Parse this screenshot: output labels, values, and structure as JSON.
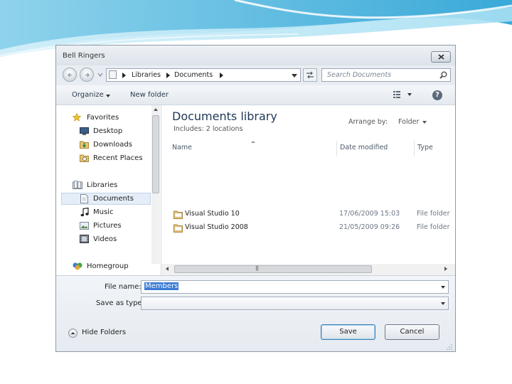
{
  "dialog": {
    "title": "Bell Ringers"
  },
  "address_bar": {
    "crumbs": [
      "Libraries",
      "Documents"
    ],
    "search_placeholder": "Search Documents"
  },
  "toolbar": {
    "organize": "Organize",
    "new_folder": "New folder"
  },
  "nav_pane": {
    "favorites": "Favorites",
    "desktop": "Desktop",
    "downloads": "Downloads",
    "recent_places": "Recent Places",
    "libraries": "Libraries",
    "documents": "Documents",
    "music": "Music",
    "pictures": "Pictures",
    "videos": "Videos",
    "homegroup": "Homegroup"
  },
  "content": {
    "library_title": "Documents library",
    "includes": "Includes: 2 locations",
    "arrange_by_label": "Arrange by:",
    "arrange_by_value": "Folder",
    "columns": {
      "name": "Name",
      "date_modified": "Date modified",
      "type": "Type"
    },
    "rows": [
      {
        "name": "Visual Studio 10",
        "date": "17/06/2009 15:03",
        "type": "File folder"
      },
      {
        "name": "Visual Studio 2008",
        "date": "21/05/2009 09:26",
        "type": "File folder"
      }
    ]
  },
  "footer": {
    "file_name_label": "File name:",
    "file_name_value": "Members",
    "save_as_type_label": "Save as type:",
    "save_as_type_value": "",
    "hide_folders": "Hide Folders",
    "save": "Save",
    "cancel": "Cancel"
  },
  "colors": {
    "accent": "#3a7bd5",
    "title_text": "#1e3856",
    "selection": "#e4edf8"
  }
}
